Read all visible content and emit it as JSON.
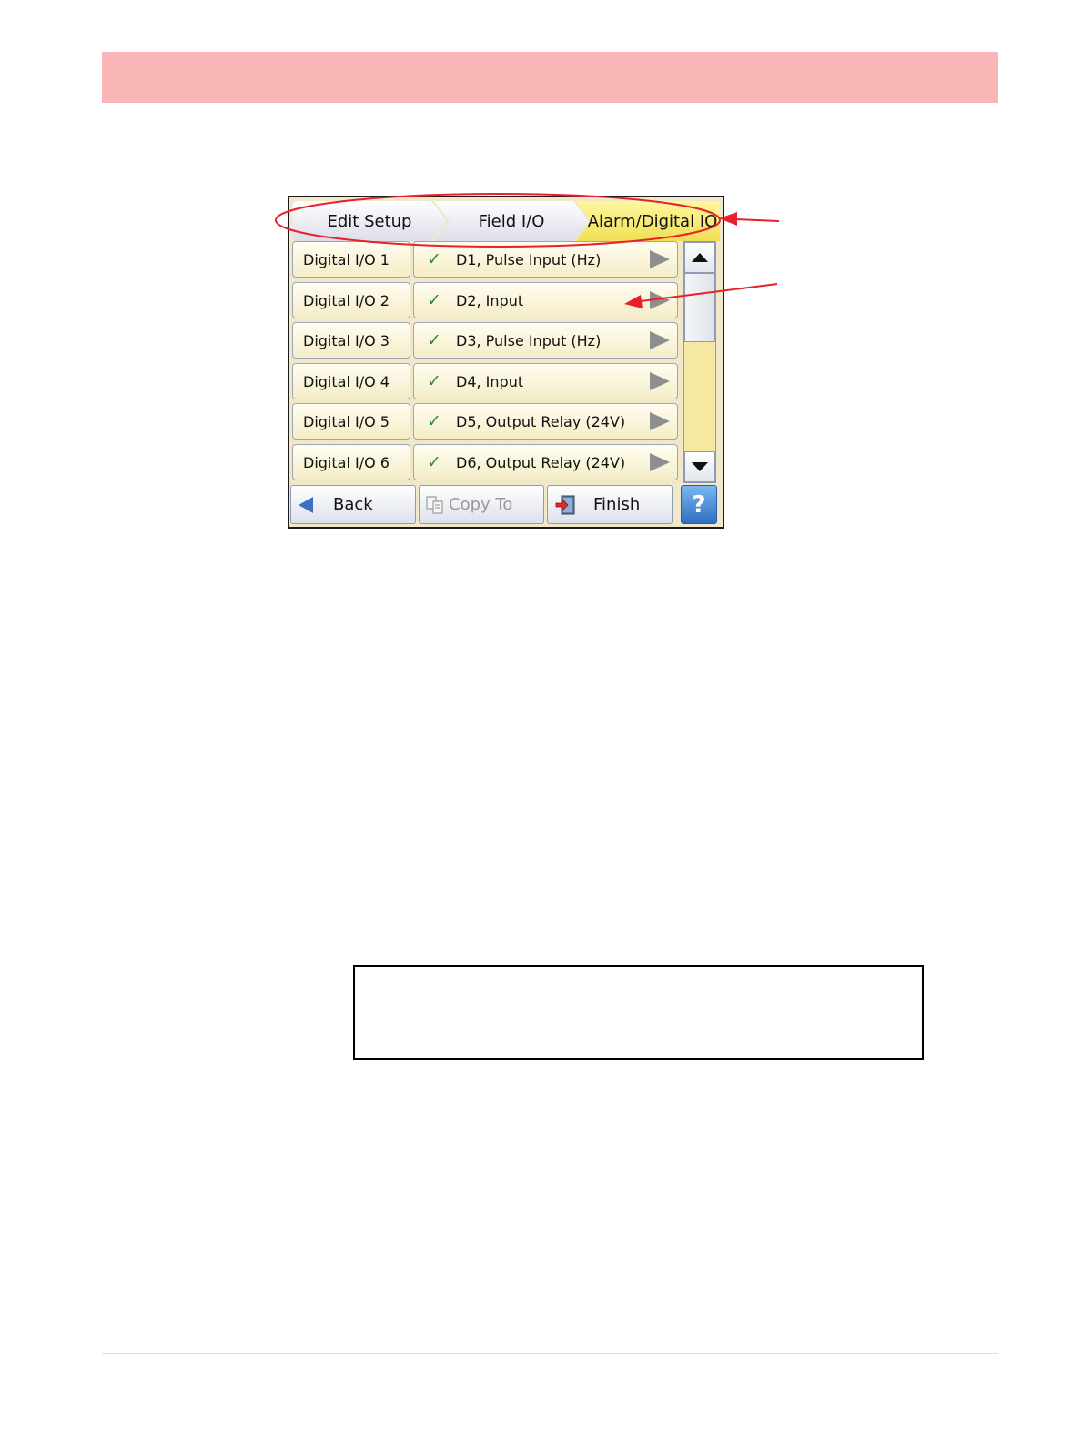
{
  "breadcrumb": [
    {
      "label": "Edit Setup"
    },
    {
      "label": "Field I/O"
    },
    {
      "label": "Alarm/Digital IO"
    }
  ],
  "rows": [
    {
      "label": "Digital I/O 1",
      "value": "D1, Pulse Input  (Hz)"
    },
    {
      "label": "Digital I/O 2",
      "value": "D2, Input"
    },
    {
      "label": "Digital I/O 3",
      "value": "D3, Pulse Input  (Hz)"
    },
    {
      "label": "Digital I/O 4",
      "value": "D4, Input"
    },
    {
      "label": "Digital I/O 5",
      "value": "D5, Output Relay (24V)"
    },
    {
      "label": "Digital I/O 6",
      "value": "D6, Output Relay (24V)"
    }
  ],
  "check_glyph": "✓",
  "buttons": {
    "back": "Back",
    "copy_to": "Copy To",
    "finish": "Finish",
    "help": "?"
  },
  "colors": {
    "header_band": "#fbb7b7",
    "active_crumb": "#f0df54",
    "annotation": "#e8202a",
    "help_button": "#2f6fc4"
  },
  "icons": [
    "back-arrow-icon",
    "copy-icon",
    "finish-door-icon",
    "help-icon",
    "scroll-up-icon",
    "scroll-down-icon",
    "row-arrow-icon",
    "check-icon"
  ]
}
